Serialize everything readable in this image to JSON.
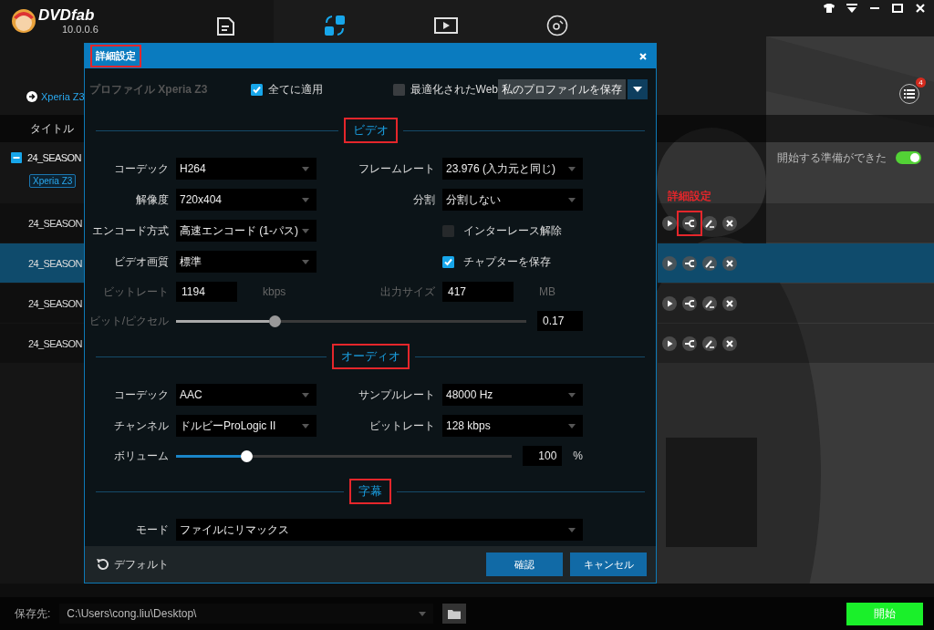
{
  "app": {
    "logo_text": "DVDfab",
    "version": "10.0.0.6"
  },
  "nav_tabs": [
    {
      "kind": "copy",
      "selected": false
    },
    {
      "kind": "convert",
      "selected": true
    },
    {
      "kind": "video",
      "selected": false
    },
    {
      "kind": "disc",
      "selected": false
    }
  ],
  "window_controls": [
    {
      "kind": "skin"
    },
    {
      "kind": "menu"
    },
    {
      "kind": "minimize"
    },
    {
      "kind": "maximize"
    },
    {
      "kind": "close"
    }
  ],
  "profile_link": "Xperia Z3",
  "queue_badge": "4",
  "table": {
    "column_title": "タイトル"
  },
  "group": {
    "title": "24_SEASON",
    "expanded": true,
    "tags": [
      "Xperia Z3"
    ],
    "status": "開始する準備ができた",
    "ready": true
  },
  "rows": [
    {
      "title": "24_SEASON",
      "selected": false,
      "highlighted": true,
      "callout": "詳細設定"
    },
    {
      "title": "24_SEASON",
      "selected": true,
      "highlighted": false
    },
    {
      "title": "24_SEASON",
      "selected": false,
      "highlighted": false
    },
    {
      "title": "24_SEASON",
      "selected": false,
      "highlighted": false
    }
  ],
  "save_bar": {
    "label": "保存先:",
    "path": "C:\\Users\\cong.liu\\Desktop\\",
    "start": "開始"
  },
  "dialog": {
    "title": "詳細設定",
    "title_highlighted": true,
    "profile_label": "プロファイル Xperia Z3",
    "options": [
      {
        "label": "全てに適用",
        "checked": true
      },
      {
        "label": "最適化されたWeb",
        "checked": false
      }
    ],
    "save_profile": "私のプロファイルを保存",
    "sections": [
      {
        "title": "ビデオ",
        "highlighted": true,
        "rows": [
          [
            {
              "kind": "select",
              "label": "コーデック",
              "value": "H264"
            },
            {
              "kind": "select",
              "label": "フレームレート",
              "value": "23.976 (入力元と同じ)"
            }
          ],
          [
            {
              "kind": "select",
              "label": "解像度",
              "value": "720x404"
            },
            {
              "kind": "select",
              "label": "分割",
              "value": "分割しない"
            }
          ],
          [
            {
              "kind": "select",
              "label": "エンコード方式",
              "value": "高速エンコード (1-パス)"
            },
            {
              "kind": "checkbox",
              "label": "インターレース解除",
              "checked": false,
              "disabled": true
            }
          ],
          [
            {
              "kind": "select",
              "label": "ビデオ画質",
              "value": "標準"
            },
            {
              "kind": "checkbox",
              "label": "チャプターを保存",
              "checked": true,
              "disabled": false
            }
          ],
          [
            {
              "kind": "input",
              "label": "ビットレート",
              "value": "1194",
              "unit": "kbps",
              "disabled": true
            },
            {
              "kind": "input",
              "label": "出力サイズ",
              "value": "417",
              "unit": "MB",
              "disabled": true
            }
          ],
          [
            {
              "kind": "slider",
              "label": "ビット/ピクセル",
              "level": 0.28,
              "value": "0.17",
              "disabled": true
            }
          ]
        ]
      },
      {
        "title": "オーディオ",
        "highlighted": true,
        "rows": [
          [
            {
              "kind": "select",
              "label": "コーデック",
              "value": "AAC"
            },
            {
              "kind": "select",
              "label": "サンプルレート",
              "value": "48000 Hz"
            }
          ],
          [
            {
              "kind": "select",
              "label": "チャンネル",
              "value": "ドルビーProLogic II"
            },
            {
              "kind": "select",
              "label": "ビットレート",
              "value": "128 kbps"
            }
          ],
          [
            {
              "kind": "slider",
              "label": "ボリューム",
              "level": 0.21,
              "value": "100",
              "unit": "%",
              "disabled": false
            }
          ]
        ]
      },
      {
        "title": "字幕",
        "highlighted": true,
        "rows": [
          [
            {
              "kind": "select",
              "label": "モード",
              "value": "ファイルにリマックス",
              "wide": true
            }
          ]
        ]
      }
    ],
    "footer": {
      "default": "デフォルト",
      "buttons": [
        "確認",
        "キャンセル"
      ]
    }
  }
}
